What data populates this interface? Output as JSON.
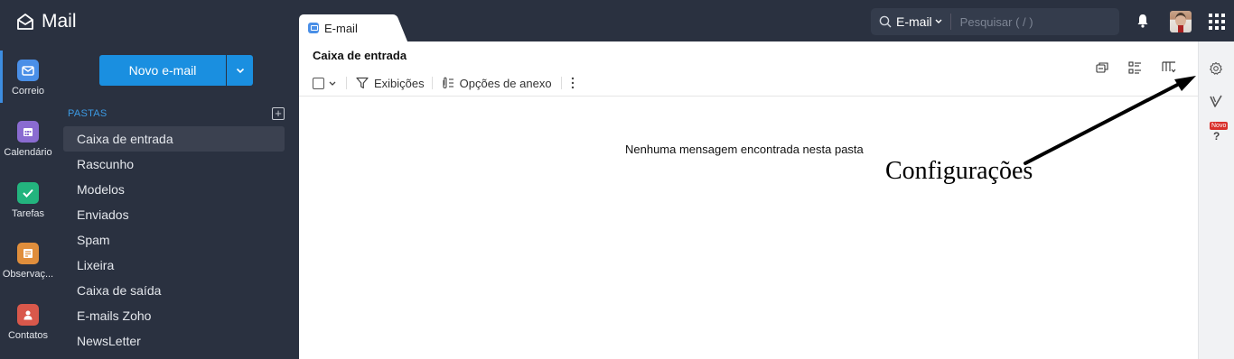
{
  "app": {
    "title": "Mail"
  },
  "tab": {
    "label": "E-mail"
  },
  "search": {
    "scope": "E-mail",
    "placeholder": "Pesquisar ( / )"
  },
  "rail": {
    "items": [
      {
        "label": "Correio",
        "icon": "mail-icon",
        "color": "#4a8fe7",
        "active": true
      },
      {
        "label": "Calendário",
        "icon": "calendar-icon",
        "color": "#8a6bd1"
      },
      {
        "label": "Tarefas",
        "icon": "tasks-icon",
        "color": "#23b47e"
      },
      {
        "label": "Observaç...",
        "icon": "notes-icon",
        "color": "#e08e3c"
      },
      {
        "label": "Contatos",
        "icon": "contacts-icon",
        "color": "#d9584b"
      }
    ]
  },
  "compose": {
    "label": "Novo e-mail"
  },
  "folders": {
    "heading": "PASTAS",
    "items": [
      {
        "label": "Caixa de entrada",
        "selected": true
      },
      {
        "label": "Rascunho"
      },
      {
        "label": "Modelos"
      },
      {
        "label": "Enviados"
      },
      {
        "label": "Spam"
      },
      {
        "label": "Lixeira"
      },
      {
        "label": "Caixa de saída"
      },
      {
        "label": "E-mails Zoho"
      },
      {
        "label": "NewsLetter"
      }
    ]
  },
  "main": {
    "title": "Caixa de entrada",
    "toolbar": {
      "views_label": "Exibições",
      "attachment_label": "Opções de anexo"
    },
    "empty_message": "Nenhuma mensagem encontrada nesta pasta"
  },
  "annotation": {
    "text": "Configurações"
  },
  "right_rail": {
    "new_badge": "Novo",
    "help": "?"
  },
  "colors": {
    "accent": "#1a8fe0",
    "sidebar_bg": "#2a3140",
    "folder_heading": "#3c9ae3",
    "badge": "#d9302b"
  }
}
